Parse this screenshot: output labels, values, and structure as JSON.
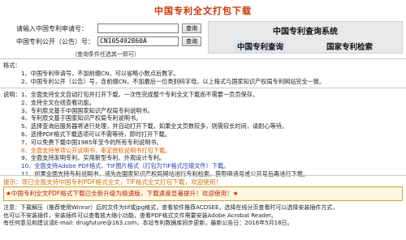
{
  "title": "中国专利全文打包下载",
  "form": {
    "app_no_label": "请输入中国专利申请号：",
    "app_no_value": "",
    "query_btn": "查询",
    "pub_no_label": "中国专利公开（公告）号：",
    "pub_no_value": "CN105492860A",
    "query_btn2": "查询",
    "group_query_label": "（查询条件任选其一即可）"
  },
  "system": {
    "title": "中国专利查询系统",
    "link1": "中国专利查询",
    "link2": "国家专利检索"
  },
  "format": {
    "heading": "格式：",
    "items": [
      "1、中国专利申请号，不加前缀CN，可以省略小数点后数字。",
      "2、中国专利公开（公告）号，含前缀CN，不加最后一位类别码字母。以上格式与国家知识产权局专利网站完全一致。"
    ]
  },
  "explain": {
    "heading": "说明：",
    "items": [
      {
        "text": "1、全面支持全文自动打包并打开下载，一次性完成整个专利全文下载而不需要一页页保存。",
        "style": ""
      },
      {
        "text": "2、支持全文在线查看功能。",
        "style": ""
      },
      {
        "text": "3、专利原文基于中国国家知识产权局专利说明书。",
        "style": ""
      },
      {
        "text": "4、专利原文基于国家知识产权局专利说明书。",
        "style": ""
      },
      {
        "text": "5、选择查询后服务器将进行处理，并自动打开下载，如果全文页数较多，则需较长时间，请耐心等待。",
        "style": ""
      },
      {
        "text": "6、选择PDF格式下载选项可以不需等待，即时打开下载。",
        "style": ""
      },
      {
        "text": "7、可以免费下载中国1985年至今的所有专利说明书。",
        "style": ""
      },
      {
        "text": "8、全面支持单项公开说明书，审定授权说明书打包下载。",
        "style": "orange"
      },
      {
        "text": "9、全面支持发明专利、实用新型专利、外观设计专利。",
        "style": ""
      },
      {
        "text": "10、全面支持Adobe PDF格式、TIF图片格式（打包为TIF格式压缩文件）下载。",
        "style": "blue"
      },
      {
        "text": "11、如果全面支持专利说明书，请先在国家知识产权局网站进行专利检索，获取申请号或公开号后再进行下载。",
        "style": ""
      }
    ]
  },
  "tip": "提示：现已全面支持中国专利PDF格式全文，TIF格式全文打包下载，欢迎使用！",
  "notice": "★中国专利全文PDF格式下载已全新升级为极速版，下载速度显著提升！欢迎使用！★",
  "footer": {
    "line1": "注意：下载解压（推荐使用Winrar）后的文件为tif或jpg格式，查看软件推荐ACDSEE，选择在线分页查看时可以选择安装插件方式，",
    "line2": "也可以不安装插件，安装插件可以查看放大缩小功能，查看PDF格式文件需要安装Adobe Acrobat Reader。",
    "line3": "有任何意见和建议请E-mail: drugfuture@163.com，本站专利数据库同步更新，最新公告日：2016年5月18日。"
  },
  "colors": {
    "title": "#cc3300",
    "accent_orange": "#e06000",
    "link_blue": "#1a4bb3",
    "notice_red": "#c02000"
  }
}
